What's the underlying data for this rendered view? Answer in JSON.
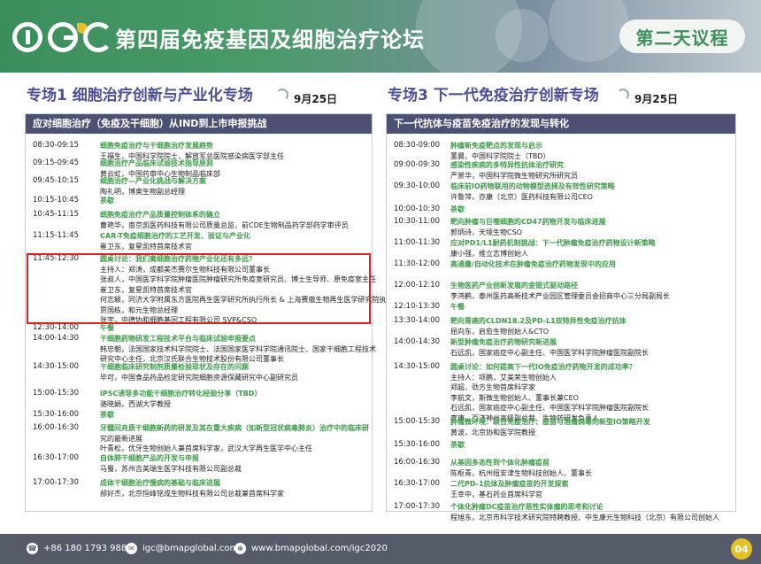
{
  "header": {
    "logo_text": "iGC",
    "title": "第四届免疫基因及细胞治疗论坛",
    "day_badge": "第二天议程"
  },
  "left": {
    "title": "专场1 细胞治疗创新与产业化专场",
    "date": "9月25日",
    "panel_title": "应对细胞治疗（免疫及干细胞）从IND到上市申报挑战",
    "rows": [
      {
        "time": "08:30-09:15",
        "lines": [
          "细胞免疫治疗与干细胞治疗发展趋势",
          "王福生，中国科学院院士，解放军总医院感染病医学部主任"
        ]
      },
      {
        "time": "09:15-09:45",
        "lines": [
          "细胞治疗产品临床试验技术指导原则",
          "黄云虹，中国药审中心生物制品临床部"
        ]
      },
      {
        "time": "09:45-10:15",
        "lines": [
          "细胞治疗—产业化挑战与解决方案",
          "陶礼明，博奥生物副总经理"
        ]
      },
      {
        "time": "10:15-10:45",
        "lines": [
          "茶歇"
        ]
      },
      {
        "time": "10:45-11:15",
        "lines": [
          "细胞免疫治疗产品质量控制体系的确立",
          "曹艳华，南京凯医药科技有限公司质量总监，前CDE生物制品药学部药学审评员"
        ]
      },
      {
        "time": "11:15-11:45",
        "lines": [
          "CAR-T免疫细胞治疗的工艺开发、验证与产业化",
          "崔卫东，复星凯特首席技术官"
        ]
      },
      {
        "time": "11:45-12:30",
        "lines": [
          "圆桌讨论：我们离细胞治疗药物产业化还有多远？",
          "主持人：郑涛，成都美杰赛尔生物科技有限公司董事长",
          "张叔人，中国医学科学院肿瘤医院肿瘤研究所免疫室研究员、博士生导师、原免疫室主任",
          "崔卫东，复星凯特首席技术官",
          "何志颖，同济大学附属东方医院再生医学研究所执行所长 & 上海赛傲生物再生医学研究院执行院长",
          "贾国栋，和元生物总经理",
          "张宇，中德协和细胞基因工程有限公司 SVP&CSO"
        ]
      },
      {
        "time": "12:30-14:00",
        "lines": [
          "午餐"
        ]
      },
      {
        "time": "14:00-14:30",
        "lines": [
          "干细胞药物研发工程技术平台与临床试验申报要点",
          "韩忠朝，法国国家技术科学院院士、法国国家医学科学院通讯院士、国家干细胞工程技术",
          "研究中心主任，北京汉氏联合生物技术股份有限公司董事长"
        ]
      },
      {
        "time": "14:30-15:00",
        "lines": [
          "干细胞临床研究制剂质量检验现状及存在的问题",
          "毕可，中国食品药品检定研究院细胞资源保藏研究中心副研究员"
        ]
      },
      {
        "time": "15:00-15:30",
        "lines": [
          "iPSC诱导多功能干细胞治疗转化经验分享（TBD）",
          "骆晓娟，西湖大学教授"
        ]
      },
      {
        "time": "15:30-16:00",
        "lines": [
          "茶歇"
        ]
      },
      {
        "time": "16:00-16:30",
        "lines": [
          "牙髓间充质干细胞新药的研发及其在重大疾病（如新型冠状病毒肺炎）治疗中的临床研",
          "究的最新进展",
          "叶青松，优牙生物创始人兼首席科学家，武汉大学再生医学中心主任"
        ]
      },
      {
        "time": "16:30-17:00",
        "lines": [
          "自体肺干细胞产品的开发与申报",
          "马蜀，苏州吉美瑞生医学科技有限公司副总裁"
        ]
      },
      {
        "time": "17:00-17:30",
        "lines": [
          "成体干细胞治疗慢病的基础与临床进展",
          "郝好杰，北京恒峰铭成生物科技有限公司总裁兼首席科学家"
        ]
      }
    ]
  },
  "right": {
    "title": "专场3 下一代免疫治疗创新专场",
    "date": "9月25日",
    "panel_title": "下一代抗体与疫苗免疫治疗的发现与转化",
    "rows": [
      {
        "time": "08:30-09:00",
        "lines": [
          "肿瘤新免疫靶点的发现与启示",
          "董晨，中国科学院院士（TBD）"
        ]
      },
      {
        "time": "09:00-09:30",
        "lines": [
          "感染性疾病的多特异性抗体治疗研究",
          "严景华，中国科学院微生物研究所研究员"
        ]
      },
      {
        "time": "09:30-10:00",
        "lines": [
          "临床前IO药物联用的动物模型选择及有效性研究策略",
          "许鲁萍，亦康（北京）医药科技有限公司CEO"
        ]
      },
      {
        "time": "10:00-10:30",
        "lines": [
          "茶歇"
        ]
      },
      {
        "time": "10:30-11:00",
        "lines": [
          "靶向肿瘤与巨噬细胞的CD47药物开发与临床进展",
          "郭炳诗，天境生物CSO"
        ]
      },
      {
        "time": "11:00-11:30",
        "lines": [
          "应对PD1/L1耐药机制挑战：下一代肿瘤免疫治疗药物设计新策略",
          "康小强，维立志博创始人"
        ]
      },
      {
        "time": "11:30-12:00",
        "lines": [
          "高通量/自动化技术在肿瘤免疫治疗药物发现中的应用"
        ]
      },
      {
        "time": "12:00-12:10",
        "lines": [
          "生物医药产业创新发展的金银式驱动路径",
          "李鸿鹤，泰州医药高新技术产业园区管理委员会招商中心三分局副局长"
        ]
      },
      {
        "time": "12:10-13:30",
        "lines": [
          "午餐"
        ]
      },
      {
        "time": "13:30-14:00",
        "lines": [
          "靶向胃癌的CLDN18.2及PD-L1双特异性免疫治疗抗体",
          "屈向东，启愈生物创始人&CTO"
        ]
      },
      {
        "time": "14:00-14:30",
        "lines": [
          "新型肿瘤免疫治疗药物研究新进展",
          "石远凯，国家癌症中心副主任、中国医学科学院肿瘤医院副院长"
        ]
      },
      {
        "time": "14:30-15:00",
        "lines": [
          "圆桌讨论：如何提高下一代IO免疫治疗药物开发的成功率？",
          "主持人：项鹏，艾美荣生物创始人",
          "郑超，劲方生物首席科学家",
          "李航文，斯微生物创始人、董事长兼CEO",
          "石远凯，国家癌症中心副主任、中国医学科学院肿瘤医院副院长",
          "李康，百济神州高级副总裁、生物药研发负责人"
        ]
      },
      {
        "time": "15:00-15:30",
        "lines": [
          "肿瘤微环境：联合免疫治疗、疫苗与溶瘤病毒的新型IO策略开发",
          "黄波，北京协和医学院教授"
        ]
      },
      {
        "time": "15:30-16:00",
        "lines": [
          "茶歇"
        ]
      },
      {
        "time": "16:00-16:30",
        "lines": [
          "从基因多态性到个体化肿瘤疫苗",
          "陈枢青，杭州纽安津生物科技创始人、董事长"
        ]
      },
      {
        "time": "16:30-17:00",
        "lines": [
          "二代PD-1抗体及肿瘤疫苗的开发探索",
          "王幸中，基石药业首席科学官"
        ]
      },
      {
        "time": "17:00-17:30",
        "lines": [
          "个体化肿瘤DC疫苗治疗恶性实体瘤的思考和讨论",
          "程旭东，北京市科学技术研究院特聘教授、中生康元生物科技（北京）有限公司创始人"
        ]
      }
    ]
  },
  "footer": {
    "phone": "+86 180 1793 9885",
    "email": "igc@bmapglobal.com",
    "web": "www.bmapglobal.com/igc2020",
    "page": "04"
  }
}
